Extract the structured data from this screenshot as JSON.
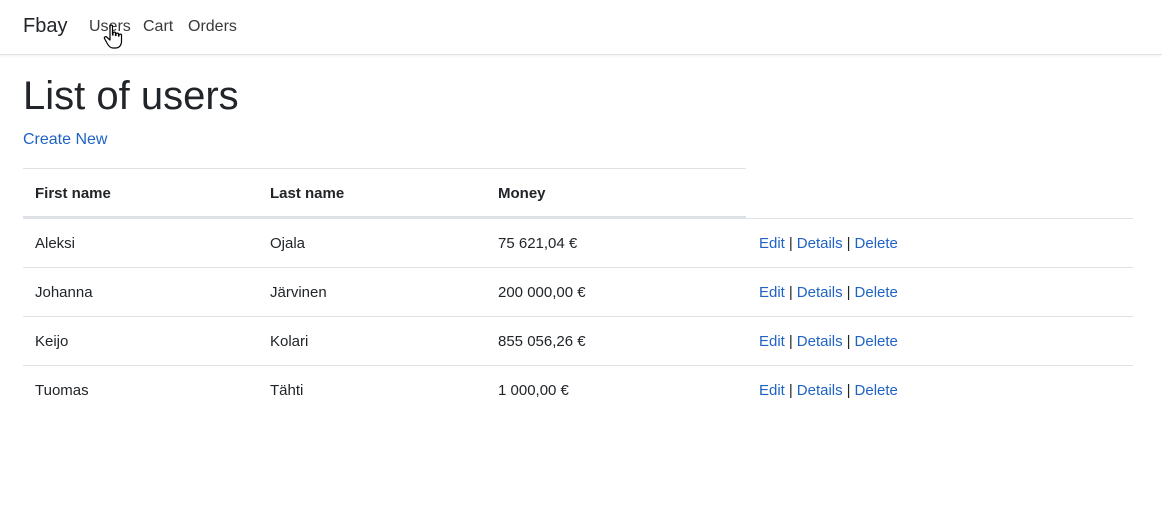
{
  "navbar": {
    "brand": "Fbay",
    "links": [
      "Users",
      "Cart",
      "Orders"
    ]
  },
  "main": {
    "title": "List of users",
    "create_link": "Create New",
    "table": {
      "headers": [
        "First name",
        "Last name",
        "Money"
      ],
      "rows": [
        {
          "first": "Aleksi",
          "last": "Ojala",
          "money": "75 621,04 €"
        },
        {
          "first": "Johanna",
          "last": "Järvinen",
          "money": "200 000,00 €"
        },
        {
          "first": "Keijo",
          "last": "Kolari",
          "money": "855 056,26 €"
        },
        {
          "first": "Tuomas",
          "last": "Tähti",
          "money": "1 000,00 €"
        }
      ],
      "actions": {
        "edit": "Edit",
        "details": "Details",
        "delete": "Delete",
        "separator": "|"
      }
    }
  },
  "colors": {
    "link": "#1f63c4",
    "text": "#212529",
    "border": "#dee2e6"
  }
}
